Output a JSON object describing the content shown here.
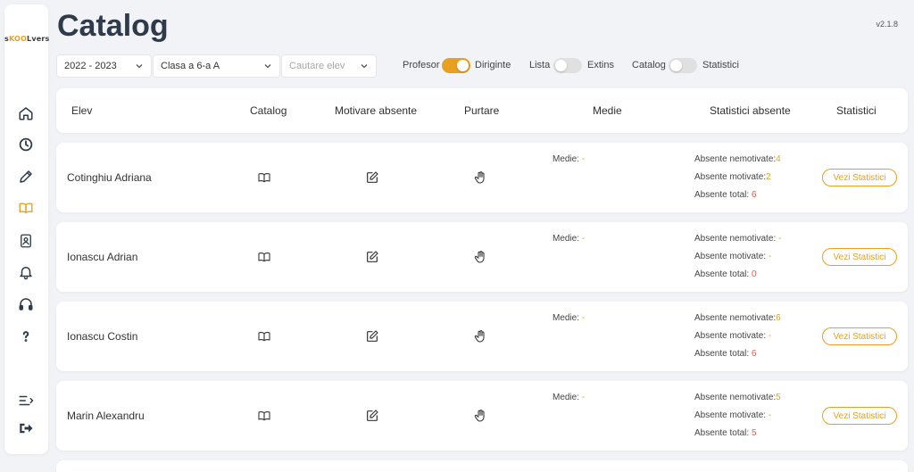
{
  "app": {
    "logo": {
      "s": "s",
      "k": "K",
      "oo": "OO",
      "lvers": "Lvers"
    },
    "version": "v2.1.8"
  },
  "page": {
    "title": "Catalog"
  },
  "filters": {
    "year": "2022 - 2023",
    "class": "Clasa a 6-a A",
    "search_placeholder": "Cautare elev"
  },
  "toggles": [
    {
      "left": "Profesor",
      "right": "Diriginte",
      "on": true
    },
    {
      "left": "Lista",
      "right": "Extins",
      "on": false
    },
    {
      "left": "Catalog",
      "right": "Statistici",
      "on": false
    }
  ],
  "columns": {
    "elev": "Elev",
    "catalog": "Catalog",
    "motivare": "Motivare absente",
    "purtare": "Purtare",
    "medie": "Medie",
    "stat_abs": "Statistici absente",
    "statistici": "Statistici"
  },
  "labels": {
    "medie": "Medie:",
    "nemotivate": "Absente nemotivate:",
    "motivate": "Absente motivate:",
    "total": "Absente total:",
    "vezi": "Vezi Statistici"
  },
  "students": [
    {
      "name": "Cotinghiu Adriana",
      "medie": "-",
      "nemotivate": "4",
      "motivate": "2",
      "total": "6"
    },
    {
      "name": "Ionascu Adrian",
      "medie": "-",
      "nemotivate": "-",
      "motivate": "-",
      "total": "0"
    },
    {
      "name": "Ionascu Costin",
      "medie": "-",
      "nemotivate": "6",
      "motivate": "-",
      "total": "6"
    },
    {
      "name": "Marin Alexandru",
      "medie": "-",
      "nemotivate": "5",
      "motivate": "-",
      "total": "5"
    }
  ],
  "colors": {
    "accent": "#e8a020",
    "red": "#e05a4c"
  },
  "icons": {
    "sidebar": [
      "home-icon",
      "clock-icon",
      "pencil-icon",
      "book-icon",
      "report-icon",
      "bell-icon",
      "headset-icon",
      "help-icon",
      "menu-collapse-icon",
      "logout-icon"
    ],
    "row": [
      "book-icon",
      "edit-icon",
      "hand-icon"
    ]
  }
}
